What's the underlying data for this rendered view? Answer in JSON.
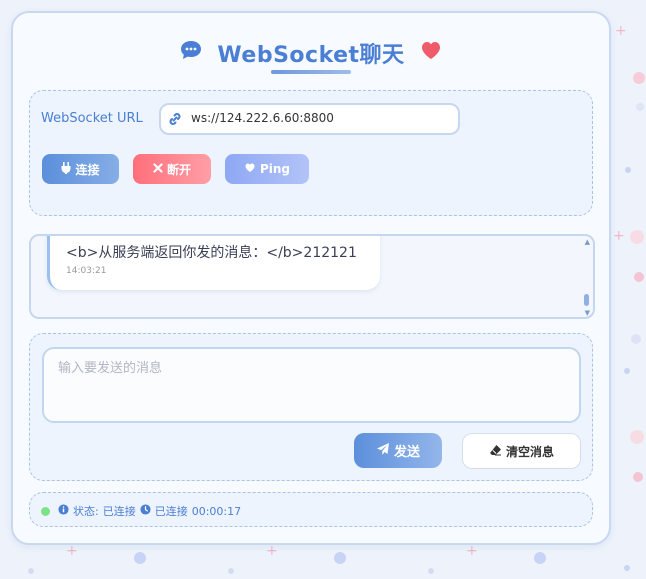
{
  "app": {
    "title": "WebSocket聊天"
  },
  "connection": {
    "url_label": "WebSocket URL",
    "url_value": "ws://124.222.6.60:8800"
  },
  "buttons": {
    "connect": "连接",
    "disconnect": "断开",
    "ping": "Ping",
    "send": "发送",
    "clear": "清空消息"
  },
  "messages": [
    {
      "text": "<b>从服务端返回你发的消息：</b>212121",
      "time": "14:03:21"
    }
  ],
  "composer": {
    "placeholder": "输入要发送的消息"
  },
  "status": {
    "label": "状态:",
    "state": "已连接",
    "duration_state": "已连接",
    "duration": "00:00:17"
  },
  "colors": {
    "accent": "#4a7fd4",
    "danger": "#ff6f7b",
    "ping": "#8fa8f4",
    "online": "#7be387"
  }
}
